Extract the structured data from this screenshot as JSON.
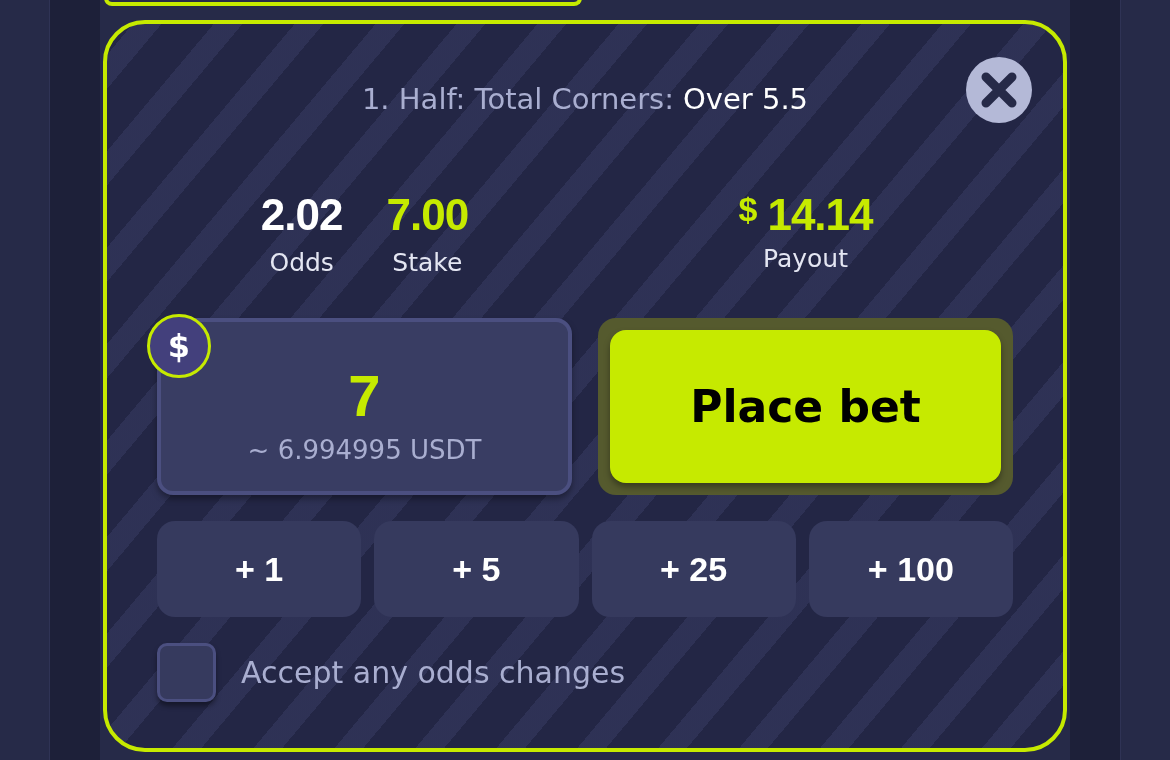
{
  "bet": {
    "market": "1. Half: Total Corners:",
    "selection": "Over 5.5"
  },
  "stats": [
    {
      "value": "2.02",
      "label": "Odds",
      "highlight": false
    },
    {
      "value": "7.00",
      "label": "Stake",
      "highlight": true
    }
  ],
  "payout": {
    "currency": "$",
    "value": "14.14",
    "label": "Payout"
  },
  "stake_input": {
    "currency": "$",
    "value": "7",
    "conversion": "~ 6.994995 USDT"
  },
  "place_bet": {
    "label": "Place bet"
  },
  "quick_amounts": [
    "+ 1",
    "+ 5",
    "+ 25",
    "+ 100"
  ],
  "accept_odds_changes": {
    "label": "Accept any odds changes",
    "checked": false
  }
}
